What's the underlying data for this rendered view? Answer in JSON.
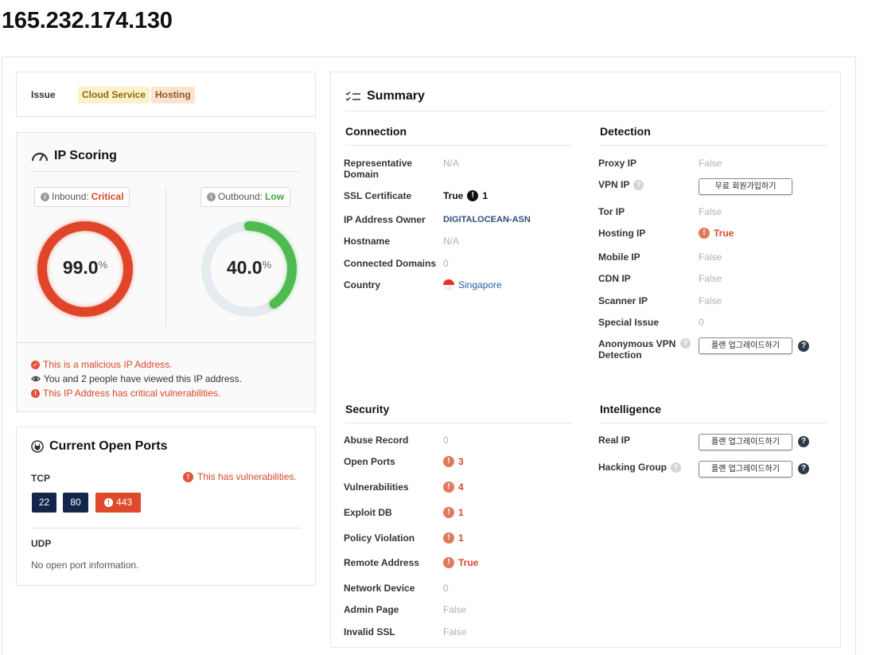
{
  "ip": "165.232.174.130",
  "issue": {
    "label": "Issue",
    "tags": [
      "Cloud Service",
      "Hosting"
    ]
  },
  "scoring": {
    "title": "IP Scoring",
    "inbound": {
      "label": "Inbound:",
      "level": "Critical",
      "value": 99.0,
      "value_text": "99.0",
      "color": "#e0452a"
    },
    "outbound": {
      "label": "Outbound:",
      "level": "Low",
      "value": 40.0,
      "value_text": "40.0",
      "color": "#4fba4f"
    },
    "percent_sign": "%",
    "alerts": [
      "This is a malicious IP Address.",
      "You and 2 people have viewed this IP address.",
      "This IP Address has critical vulnerabilities."
    ]
  },
  "ports": {
    "title": "Current Open Ports",
    "tcp_label": "TCP",
    "vuln_note": "This has vulnerabilities.",
    "tcp": [
      "22",
      "80",
      "443"
    ],
    "udp_label": "UDP",
    "udp_empty": "No open port information."
  },
  "summary": {
    "title": "Summary",
    "connection": {
      "title": "Connection",
      "rows": [
        {
          "label": "Representative Domain",
          "value": "N/A"
        },
        {
          "label": "SSL Certificate",
          "value": "True",
          "count": "1"
        },
        {
          "label": "IP Address Owner",
          "value": "DIGITALOCEAN-ASN"
        },
        {
          "label": "Hostname",
          "value": "N/A"
        },
        {
          "label": "Connected Domains",
          "value": "0"
        },
        {
          "label": "Country",
          "value": "Singapore"
        }
      ]
    },
    "detection": {
      "title": "Detection",
      "rows": [
        {
          "label": "Proxy IP",
          "value": "False"
        },
        {
          "label": "VPN IP",
          "button": "무료 회원가입하기"
        },
        {
          "label": "Tor IP",
          "value": "False"
        },
        {
          "label": "Hosting IP",
          "value": "True"
        },
        {
          "label": "Mobile IP",
          "value": "False"
        },
        {
          "label": "CDN IP",
          "value": "False"
        },
        {
          "label": "Scanner IP",
          "value": "False"
        },
        {
          "label": "Special Issue",
          "value": "0"
        },
        {
          "label": "Anonymous VPN Detection",
          "button": "플랜 업그레이드하기"
        }
      ]
    },
    "security": {
      "title": "Security",
      "rows": [
        {
          "label": "Abuse Record",
          "value": "0"
        },
        {
          "label": "Open Ports",
          "value": "3"
        },
        {
          "label": "Vulnerabilities",
          "value": "4"
        },
        {
          "label": "Exploit DB",
          "value": "1"
        },
        {
          "label": "Policy Violation",
          "value": "1"
        },
        {
          "label": "Remote Address",
          "value": "True"
        },
        {
          "label": "Network Device",
          "value": "0"
        },
        {
          "label": "Admin Page",
          "value": "False"
        },
        {
          "label": "Invalid SSL",
          "value": "False"
        }
      ]
    },
    "intelligence": {
      "title": "Intelligence",
      "rows": [
        {
          "label": "Real IP",
          "button": "플랜 업그레이드하기"
        },
        {
          "label": "Hacking Group",
          "button": "플랜 업그레이드하기"
        }
      ]
    }
  }
}
